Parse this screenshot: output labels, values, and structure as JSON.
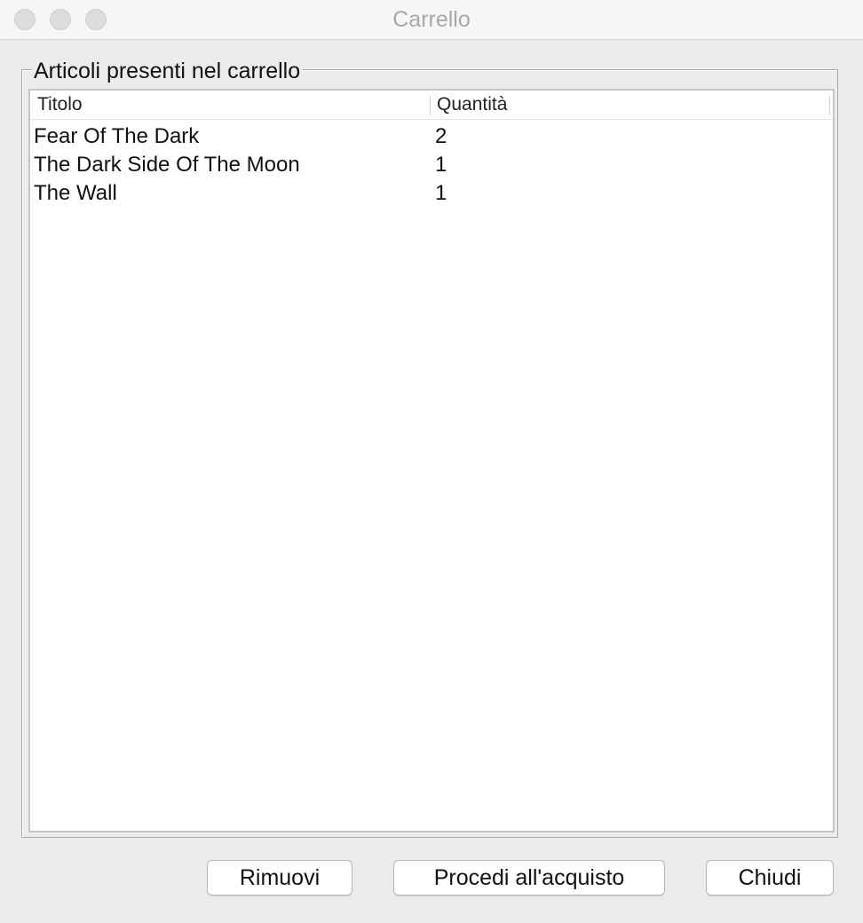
{
  "window": {
    "title": "Carrello"
  },
  "group": {
    "label": "Articoli presenti nel carrello"
  },
  "table": {
    "columns": [
      "Titolo",
      "Quantità"
    ],
    "rows": [
      {
        "titolo": "Fear Of The Dark",
        "quantita": "2"
      },
      {
        "titolo": "The Dark Side Of The Moon",
        "quantita": "1"
      },
      {
        "titolo": "The Wall",
        "quantita": "1"
      }
    ]
  },
  "buttons": {
    "remove": "Rimuovi",
    "proceed": "Procedi all'acquisto",
    "close": "Chiudi"
  }
}
